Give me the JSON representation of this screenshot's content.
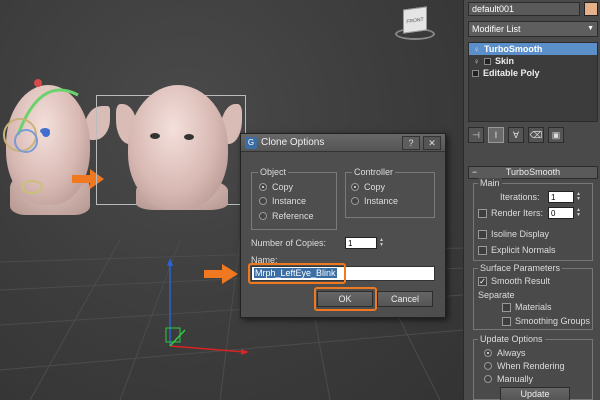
{
  "viewcube": {
    "label": "FRONT"
  },
  "dialog": {
    "title": "Clone Options",
    "help_label": "?",
    "close_label": "✕",
    "object_group": {
      "label": "Object",
      "options": [
        "Copy",
        "Instance",
        "Reference"
      ],
      "selected": "Copy"
    },
    "controller_group": {
      "label": "Controller",
      "options": [
        "Copy",
        "Instance"
      ],
      "selected": "Copy"
    },
    "copies_label": "Number of Copies:",
    "copies_value": "1",
    "name_label": "Name:",
    "name_value": "Mrph_LeftEye_Blink",
    "ok_label": "OK",
    "cancel_label": "Cancel"
  },
  "panel": {
    "object_name": "default001",
    "swatch_color": "#e8b08a",
    "modifier_list_label": "Modifier List",
    "stack": [
      {
        "label": "TurboSmooth",
        "selected": true,
        "icon": "bulb"
      },
      {
        "label": "Skin",
        "selected": false,
        "icon": "bulb"
      },
      {
        "label": "Editable Poly",
        "selected": false,
        "icon": "box"
      }
    ],
    "rollout_title": "TurboSmooth",
    "main_group_label": "Main",
    "iterations_label": "Iterations:",
    "iterations_value": "1",
    "render_iters_label": "Render Iters:",
    "render_iters_value": "0",
    "isoline_label": "Isoline Display",
    "explicit_normals_label": "Explicit Normals",
    "surface_group_label": "Surface Parameters",
    "smooth_result_label": "Smooth Result",
    "separate_label": "Separate",
    "materials_label": "Materials",
    "smoothing_groups_label": "Smoothing Groups",
    "update_group_label": "Update Options",
    "update_options": [
      "Always",
      "When Rendering",
      "Manually"
    ],
    "update_selected": "Always",
    "update_button_label": "Update"
  },
  "colors": {
    "accent": "#f07820",
    "selection": "#5b8fc9"
  }
}
